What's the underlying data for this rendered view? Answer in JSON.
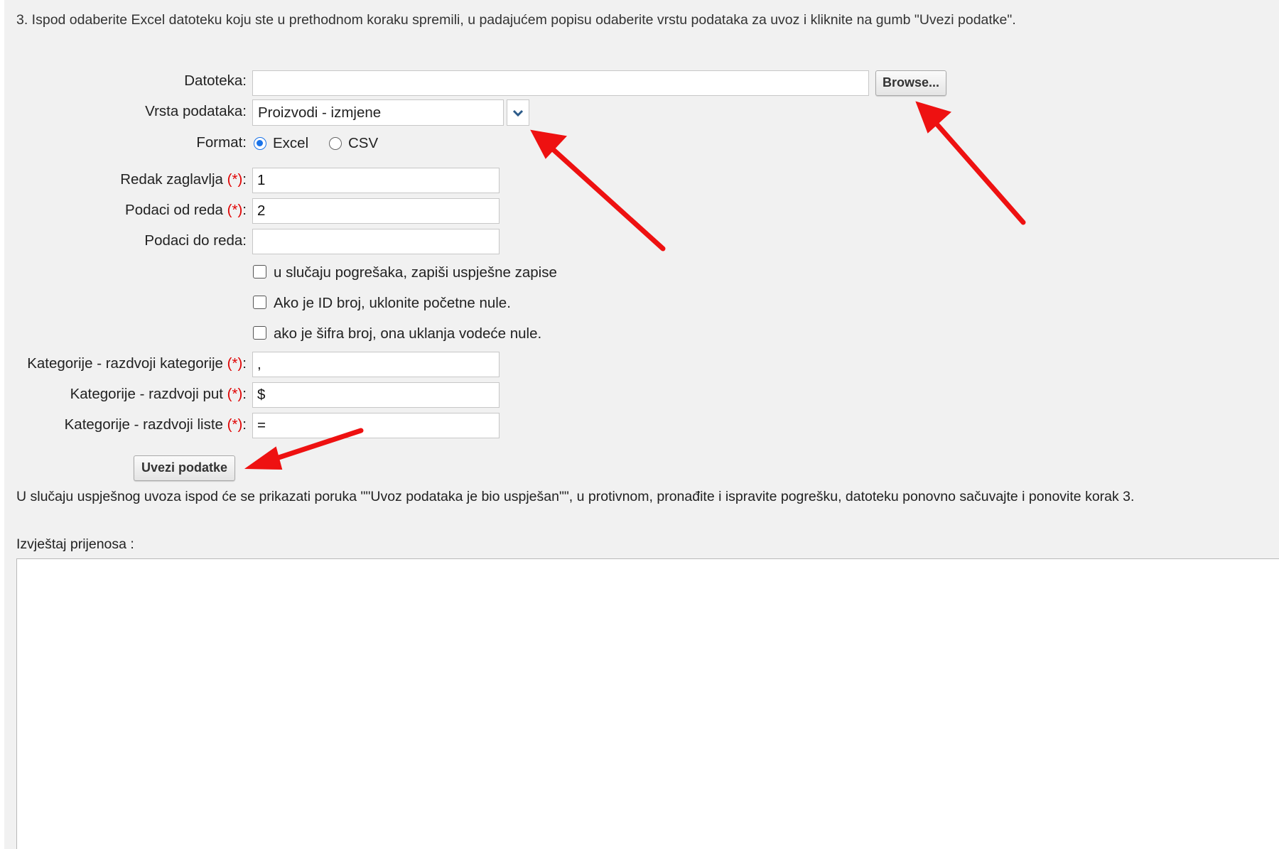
{
  "intro_text": "3. Ispod odaberite Excel datoteku koju ste u prethodnom koraku spremili, u padajućem popisu odaberite vrstu podataka za uvoz i kliknite na gumb \"Uvezi podatke\".",
  "form": {
    "file_label": "Datoteka:",
    "file_value": "",
    "browse_label": "Browse...",
    "type_label": "Vrsta podataka:",
    "type_selected": "Proizvodi - izmjene",
    "format_label": "Format:",
    "format_options": [
      "Excel",
      "CSV"
    ],
    "format_selected": "Excel",
    "header_row_label": "Redak zaglavlja",
    "header_row_value": "1",
    "data_from_label": "Podaci od reda",
    "data_from_value": "2",
    "data_to_label": "Podaci do reda:",
    "data_to_value": "",
    "required_marker": "(*)",
    "colon": ":",
    "checkboxes": [
      {
        "label": "u slučaju pogrešaka, zapiši uspješne zapise",
        "checked": false
      },
      {
        "label": "Ako je ID broj, uklonite početne nule.",
        "checked": false
      },
      {
        "label": "ako je šifra broj, ona uklanja vodeće nule.",
        "checked": false
      }
    ],
    "cat_split_label": "Kategorije - razdvoji kategorije",
    "cat_split_value": ",",
    "cat_path_label": "Kategorije - razdvoji put",
    "cat_path_value": "$",
    "cat_list_label": "Kategorije - razdvoji liste",
    "cat_list_value": "=",
    "import_button": "Uvezi podatke"
  },
  "result_text": "U slučaju uspješnog uvoza ispod će se prikazati poruka \"\"Uvoz podataka je bio uspješan\"\", u protivnom, pronađite i ispravite pogrešku, datoteku ponovno sačuvajte i ponovite korak 3.",
  "report_label": "Izvještaj prijenosa :",
  "report_content": "",
  "colors": {
    "panel_bg": "#f1f1f1",
    "required": "#e00000",
    "radio_accent": "#1a73e8",
    "annotation_arrow": "#ee1111"
  }
}
